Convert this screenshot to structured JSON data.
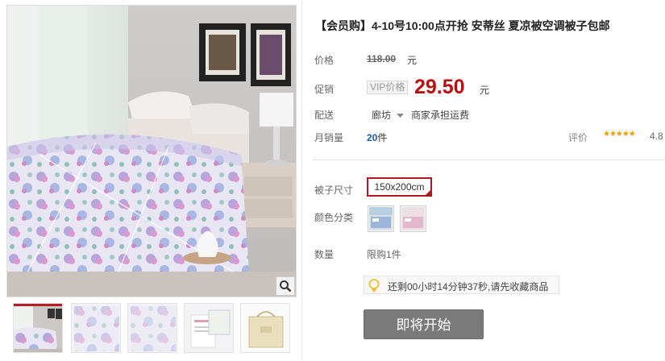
{
  "product": {
    "title": "【会员购】4-10号10:00点开抢 安蒂丝 夏凉被空调被子包邮"
  },
  "price_row": {
    "label": "价格",
    "original_price": "118.00",
    "unit": "元"
  },
  "promo_row": {
    "label": "促销",
    "tag": "VIP价格",
    "price": "29.50",
    "unit": "元"
  },
  "shipping_row": {
    "label": "配送",
    "city": "廊坊",
    "note": "商家承担运费"
  },
  "sales_row": {
    "label": "月销量",
    "count": "20",
    "count_unit": "件",
    "rating_label": "评价",
    "stars": "★★★★★",
    "rating": "4.8"
  },
  "size_row": {
    "label": "被子尺寸",
    "selected": "150x200cm"
  },
  "color_row": {
    "label": "颜色分类",
    "options": [
      "color-option-blue",
      "color-option-pink"
    ]
  },
  "qty_row": {
    "label": "数量",
    "limit": "限购1件"
  },
  "countdown": {
    "text": "还剩00小时14分钟37秒,请先收藏商品",
    "icon": "lightbulb-icon"
  },
  "cta": {
    "label": "即将开始"
  },
  "gallery": {
    "zoom_icon": "magnifier-icon",
    "thumbnails": [
      "thumb-bedroom",
      "thumb-fabric-1",
      "thumb-fabric-2",
      "thumb-label",
      "thumb-bag"
    ]
  },
  "colors": {
    "price_red": "#b80f0f",
    "selected_border": "#b0171f",
    "button_gray": "#7a7a7a",
    "sales_blue": "#1a5aa8",
    "star_gold": "#e8a100"
  }
}
